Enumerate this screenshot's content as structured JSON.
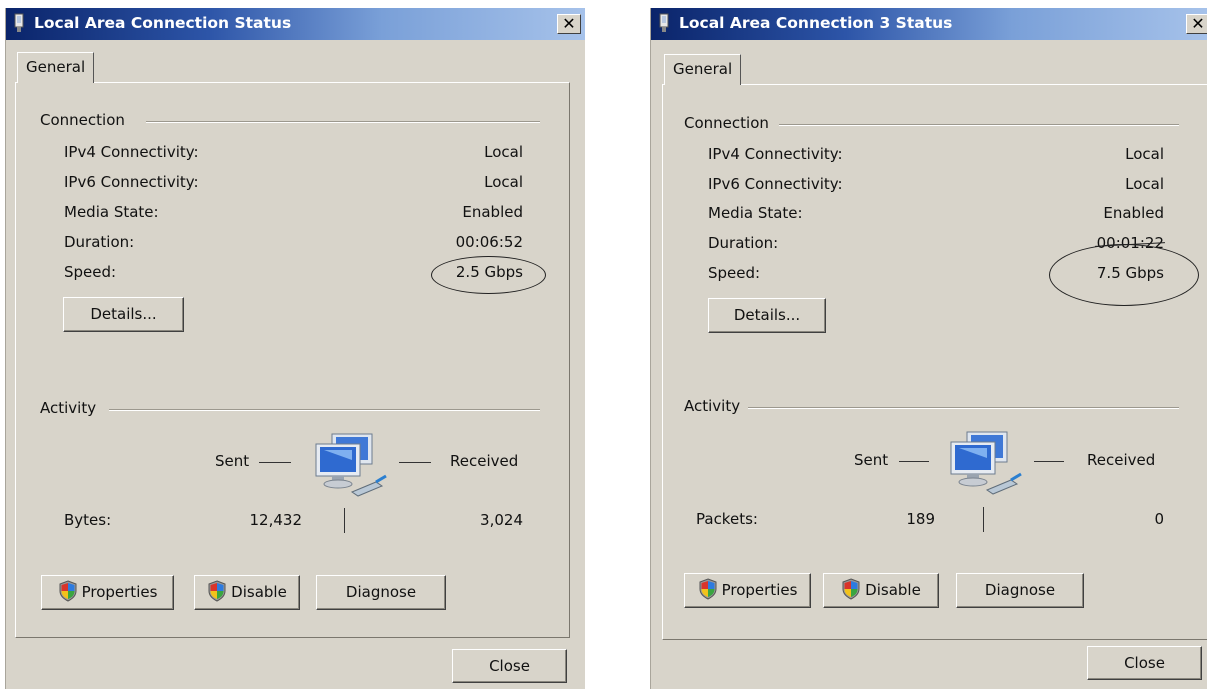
{
  "dialogs": [
    {
      "title": "Local Area Connection Status",
      "tab": "General",
      "connection": {
        "heading": "Connection",
        "rows": [
          {
            "label": "IPv4 Connectivity:",
            "value": "Local"
          },
          {
            "label": "IPv6 Connectivity:",
            "value": "Local"
          },
          {
            "label": "Media State:",
            "value": "Enabled"
          },
          {
            "label": "Duration:",
            "value": "00:06:52"
          },
          {
            "label": "Speed:",
            "value": "2.5 Gbps"
          }
        ],
        "details_button": "Details..."
      },
      "activity": {
        "heading": "Activity",
        "sent": "Sent",
        "received": "Received",
        "metric_label": "Bytes:",
        "sent_value": "12,432",
        "received_value": "3,024"
      },
      "buttons": {
        "properties": "Properties",
        "disable": "Disable",
        "diagnose": "Diagnose",
        "close": "Close"
      },
      "close_glyph": "✕"
    },
    {
      "title": "Local Area Connection 3 Status",
      "tab": "General",
      "connection": {
        "heading": "Connection",
        "rows": [
          {
            "label": "IPv4 Connectivity:",
            "value": "Local"
          },
          {
            "label": "IPv6 Connectivity:",
            "value": "Local"
          },
          {
            "label": "Media State:",
            "value": "Enabled"
          },
          {
            "label": "Duration:",
            "value": "00:01:22"
          },
          {
            "label": "Speed:",
            "value": "7.5 Gbps"
          }
        ],
        "details_button": "Details..."
      },
      "activity": {
        "heading": "Activity",
        "sent": "Sent",
        "received": "Received",
        "metric_label": "Packets:",
        "sent_value": "189",
        "received_value": "0"
      },
      "buttons": {
        "properties": "Properties",
        "disable": "Disable",
        "diagnose": "Diagnose",
        "close": "Close"
      },
      "close_glyph": "✕"
    }
  ],
  "icons": {
    "title_icon": "network-adapter-icon",
    "shield": "uac-shield-icon",
    "activity": "network-computers-icon"
  }
}
